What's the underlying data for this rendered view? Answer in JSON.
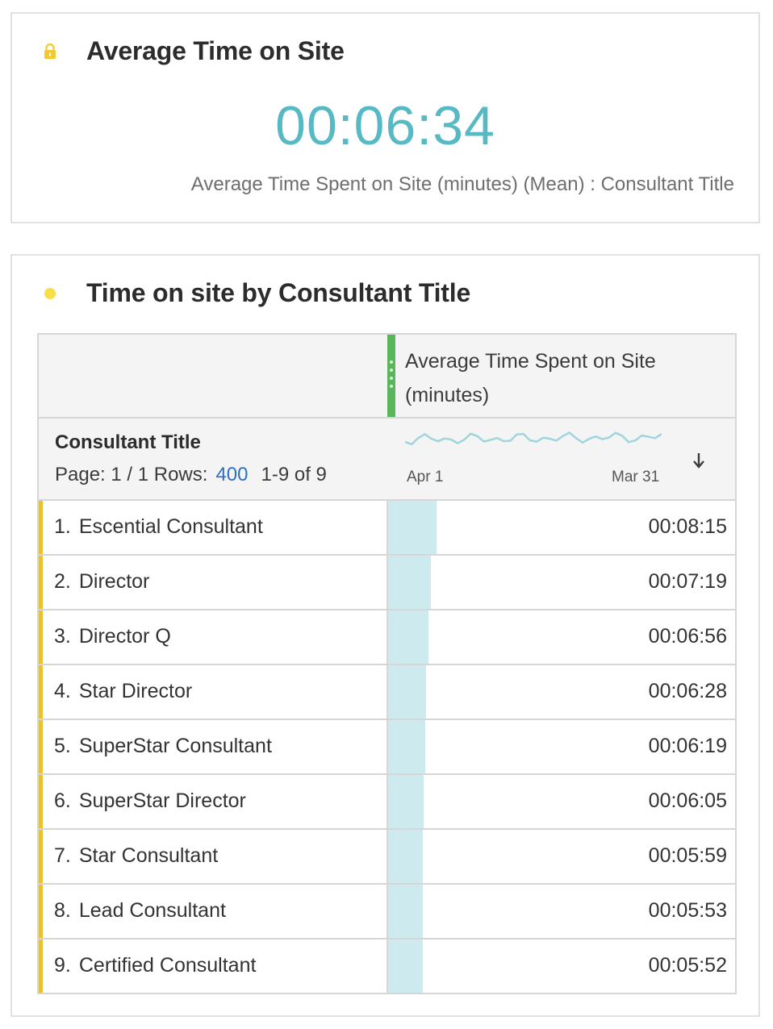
{
  "summary_panel": {
    "title": "Average Time on Site",
    "icon": "lock-icon",
    "icon_color": "#f3c930",
    "metric_value": "00:06:34",
    "metric_color": "#56b9c3",
    "caption": "Average Time Spent on Site (minutes) (Mean) : Consultant Title"
  },
  "table_panel": {
    "title": "Time on site by Consultant Title",
    "icon": "status-dot-icon",
    "icon_color": "#f6df47",
    "column_header": "Average Time Spent on Site (minutes)",
    "dimension_title": "Consultant Title",
    "page_text": "Page: 1 / 1 Rows:",
    "rows_per_page": "400",
    "range_text": "1-9 of 9",
    "sparkline_start": "Apr 1",
    "sparkline_end": "Mar 31",
    "sort_icon": "arrow-down-icon",
    "bar_color": "#cdeaee",
    "accent_color": "#e7c234",
    "sparkline_color": "#9fd5dc",
    "rows": [
      {
        "num": "1.",
        "label": "Escential Consultant",
        "value": "00:08:15",
        "minutes": 8.25
      },
      {
        "num": "2.",
        "label": "Director",
        "value": "00:07:19",
        "minutes": 7.32
      },
      {
        "num": "3.",
        "label": "Director Q",
        "value": "00:06:56",
        "minutes": 6.93
      },
      {
        "num": "4.",
        "label": "Star Director",
        "value": "00:06:28",
        "minutes": 6.47
      },
      {
        "num": "5.",
        "label": "SuperStar Consultant",
        "value": "00:06:19",
        "minutes": 6.32
      },
      {
        "num": "6.",
        "label": "SuperStar Director",
        "value": "00:06:05",
        "minutes": 6.08
      },
      {
        "num": "7.",
        "label": "Star Consultant",
        "value": "00:05:59",
        "minutes": 5.98
      },
      {
        "num": "8.",
        "label": "Lead Consultant",
        "value": "00:05:53",
        "minutes": 5.88
      },
      {
        "num": "9.",
        "label": "Certified Consultant",
        "value": "00:05:52",
        "minutes": 5.87
      }
    ]
  }
}
